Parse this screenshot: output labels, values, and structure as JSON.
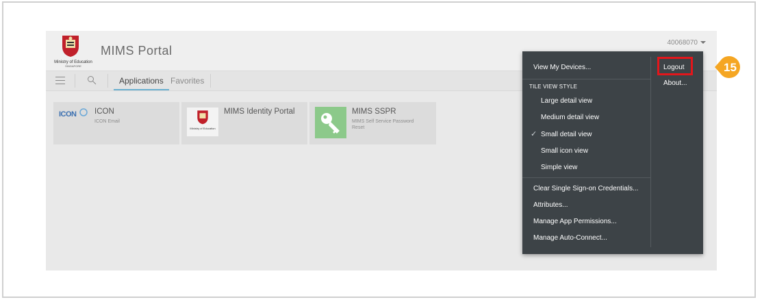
{
  "header": {
    "org_name": "Ministry of Education",
    "org_sub": "SINGAPORE",
    "portal_title": "MIMS Portal",
    "user_id": "40068070"
  },
  "toolbar": {
    "tabs": [
      {
        "label": "Applications",
        "active": true
      },
      {
        "label": "Favorites",
        "active": false
      }
    ]
  },
  "tiles": [
    {
      "name": "ICON",
      "desc": "ICON Email",
      "logo_text": "ICON"
    },
    {
      "name": "MIMS Identity Portal",
      "desc": "",
      "logo_text": "Ministry of Education"
    },
    {
      "name": "MIMS SSPR",
      "desc": "MIMS Self Service Password Reset",
      "logo_text": ""
    }
  ],
  "dropdown": {
    "view_devices": "View My Devices...",
    "tile_view_header": "TILE VIEW STYLE",
    "tile_views": [
      {
        "label": "Large detail view",
        "checked": false
      },
      {
        "label": "Medium detail view",
        "checked": false
      },
      {
        "label": "Small detail view",
        "checked": true
      },
      {
        "label": "Small icon view",
        "checked": false
      },
      {
        "label": "Simple view",
        "checked": false
      }
    ],
    "clear_sso": "Clear Single Sign-on Credentials...",
    "attributes": "Attributes...",
    "manage_permissions": "Manage App Permissions...",
    "manage_autoconnect": "Manage Auto-Connect...",
    "logout": "Logout",
    "about": "About..."
  },
  "callout": {
    "step": "15",
    "color": "#f5a623",
    "highlight_color": "#e3161b"
  },
  "icons": {
    "check": "✓",
    "menu": "hamburger-icon",
    "search": "search-icon",
    "key": "key-icon"
  }
}
